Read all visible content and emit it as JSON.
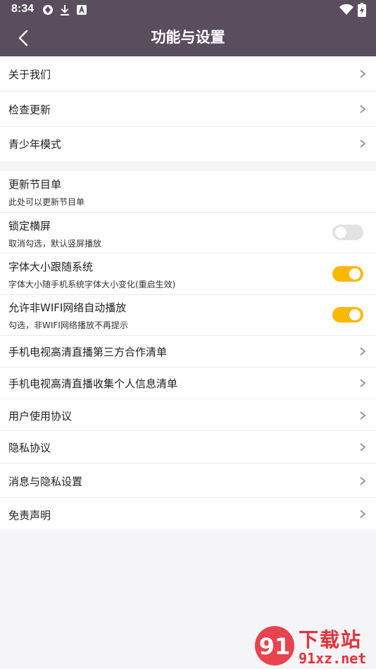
{
  "status": {
    "time": "8:34"
  },
  "header": {
    "title": "功能与设置"
  },
  "group1": [
    {
      "label": "关于我们"
    },
    {
      "label": "检查更新"
    },
    {
      "label": "青少年模式"
    }
  ],
  "group2": {
    "update_menu": {
      "label": "更新节目单",
      "sub": "此处可以更新节目单"
    },
    "lock_landscape": {
      "label": "锁定横屏",
      "sub": "取消勾选，默认竖屏播放",
      "enabled": false
    },
    "font_follow": {
      "label": "字体大小跟随系统",
      "sub": "字体大小随手机系统字体大小变化(重启生效)",
      "enabled": true
    },
    "non_wifi_autoplay": {
      "label": "允许非WIFI网络自动播放",
      "sub": "勾选，非WIFI网络播放不再提示",
      "enabled": true
    },
    "links": [
      {
        "label": "手机电视高清直播第三方合作清单"
      },
      {
        "label": "手机电视高清直播收集个人信息清单"
      },
      {
        "label": "用户使用协议"
      },
      {
        "label": "隐私协议"
      },
      {
        "label": "消息与隐私设置"
      },
      {
        "label": "免责声明"
      }
    ]
  },
  "watermark": {
    "top": "下载站",
    "bottom": "91xz.net"
  },
  "colors": {
    "topbar": "#5a4d5e",
    "toggle_on": "#fbb800",
    "toggle_off": "#e2e2e4",
    "background": "#f5f5f7",
    "watermark": "#e8303a"
  }
}
